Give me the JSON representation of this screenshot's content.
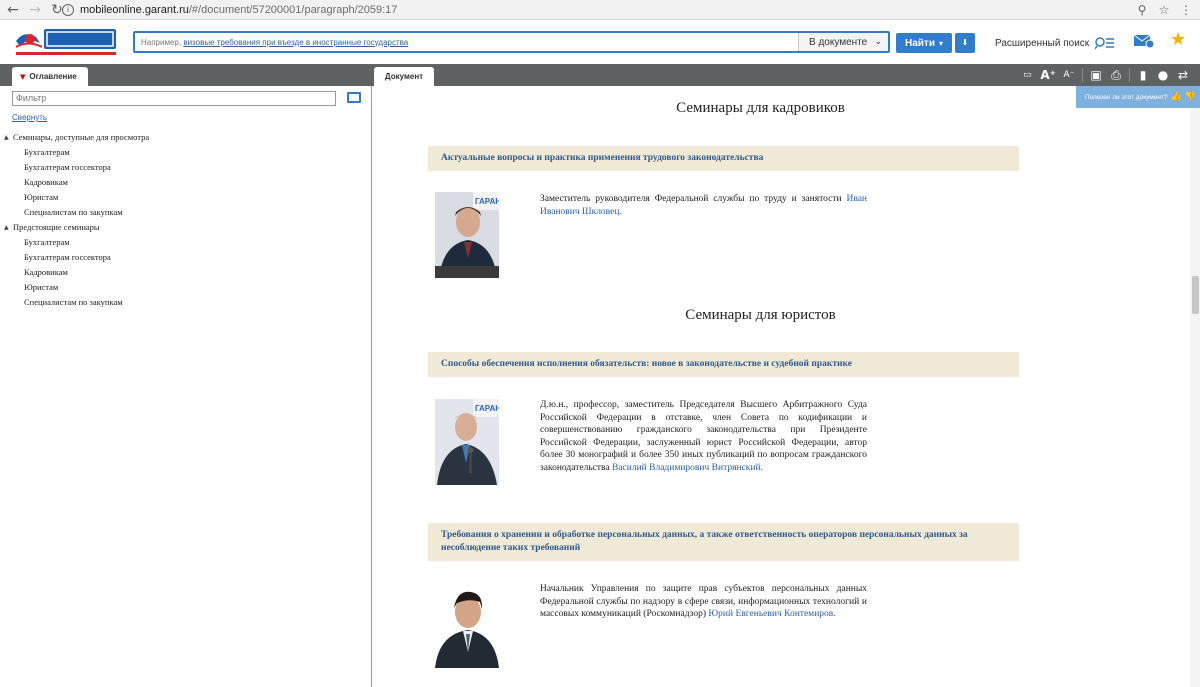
{
  "browser": {
    "url_host": "mobileonline.garant.ru",
    "url_path": "/#/document/57200001/paragraph/2059:17"
  },
  "header": {
    "search_placeholder_prefix": "Например, ",
    "search_placeholder_example": "визовые требования при въезде в иностранные государства",
    "scope_label": "В документе",
    "find_label": "Найти",
    "advanced_search_label": "Расширенный поиск"
  },
  "tabs": {
    "toc_label": "Оглавление",
    "document_label": "Документ"
  },
  "left_panel": {
    "filter_placeholder": "Фильтр",
    "collapse_label": "Свернуть",
    "tree": [
      {
        "label": "Семинары, доступные для просмотра",
        "children": [
          "Бухгалтерам",
          "Бухгалтерам госсектора",
          "Кадровикам",
          "Юристам",
          "Специалистам по закупкам"
        ]
      },
      {
        "label": "Предстоящие семинары",
        "children": [
          "Бухгалтерам",
          "Бухгалтерам госсектора",
          "Кадровикам",
          "Юристам",
          "Специалистам по закупкам"
        ]
      }
    ]
  },
  "document": {
    "helpful_label": "Полезен ли этот документ?",
    "sections": [
      {
        "title": "Семинары для кадровиков",
        "topics": [
          {
            "title": "Актуальные вопросы и практика применения трудового законодательства",
            "desc": "Заместитель руководителя Федеральной службы по труду и занятости ",
            "name": "Иван Иванович Шкловец."
          }
        ]
      },
      {
        "title": "Семинары для юристов",
        "topics": [
          {
            "title": "Способы обеспечения исполнения обязательств: новое в законодательстве и судебной практике",
            "desc": "Д.ю.н., профессор, заместитель Председателя Высшего Арбитражного Суда Российской Федерации в отставке, член Совета по кодификации и совершенствованию гражданского законодательства при Президенте Российской Федерации, заслуженный юрист Российской Федерации, автор более 30 монографий и более 350 иных публикаций по вопросам гражданского законодательства ",
            "name": "Василий Владимирович Витрянский."
          },
          {
            "title": "Требования о хранении и обработке персональных данных, а также ответственность операторов персональных данных за несоблюдение таких требований",
            "desc": "Начальник Управления по защите прав субъектов персональных данных Федеральной службы по надзору в сфере связи, информационных технологий и массовых коммуникаций (Роскомнадзор) ",
            "name": "Юрий Евгеньевич Контемиров."
          }
        ]
      }
    ]
  },
  "colors": {
    "accent": "#2f7dcb",
    "topic_bg": "#efe9d6",
    "topic_text": "#2e5a8e",
    "tabbar": "#5f6263"
  }
}
